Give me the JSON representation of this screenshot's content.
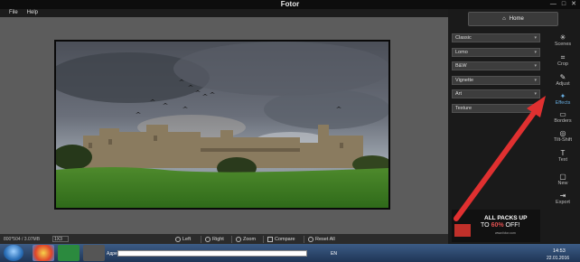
{
  "app": {
    "title": "Fotor"
  },
  "window_controls": [
    "—",
    "□",
    "✕"
  ],
  "menu": [
    "File",
    "Help"
  ],
  "image_info": {
    "dimensions": "800*504 / 3.07MB",
    "zoom": "1X3"
  },
  "toolbar": {
    "left": "Left",
    "right": "Right",
    "zoom": "Zoom",
    "compare": "Compare",
    "reset": "Reset All"
  },
  "panel": {
    "home": "Home",
    "categories": [
      "Classic",
      "Lomo",
      "B&W",
      "Vignette",
      "Art",
      "Texture"
    ]
  },
  "tools": [
    {
      "label": "Scenes",
      "icon": "scenes-icon"
    },
    {
      "label": "Crop",
      "icon": "crop-icon"
    },
    {
      "label": "Adjust",
      "icon": "adjust-icon"
    },
    {
      "label": "Effects",
      "icon": "effects-icon",
      "active": true
    },
    {
      "label": "Borders",
      "icon": "borders-icon"
    },
    {
      "label": "Tilt-Shift",
      "icon": "tilt-shift-icon"
    },
    {
      "label": "Text",
      "icon": "text-icon"
    },
    {
      "label": "New",
      "icon": "new-icon"
    },
    {
      "label": "Export",
      "icon": "export-icon"
    }
  ],
  "ad": {
    "line1": "ALL PACKS UP",
    "line2_prefix": "TO",
    "percent": "60%",
    "line2_suffix": "OFF!",
    "url": "www.fotor.com"
  },
  "taskbar": {
    "address_label": "Адрес",
    "lang": "EN",
    "time": "14:53",
    "date": "22.01.2016"
  },
  "colors": {
    "accent": "#66aadd",
    "arrow": "#e03030",
    "ad_highlight": "#e05050"
  }
}
